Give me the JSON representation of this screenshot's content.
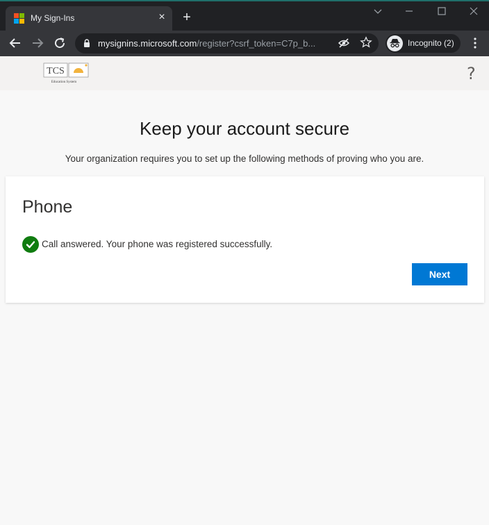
{
  "browser": {
    "tab_title": "My Sign-Ins",
    "new_tab": "+",
    "close_tab": "×",
    "url_host": "mysignins.microsoft.com",
    "url_path": "/register?csrf_token=C7p_b...",
    "incognito_label": "Incognito (2)"
  },
  "header": {
    "logo_text": "TCS",
    "logo_subtext": "Education System",
    "help_label": "?"
  },
  "main": {
    "heading": "Keep your account secure",
    "subheading": "Your organization requires you to set up the following methods of proving who you are.",
    "card": {
      "title": "Phone",
      "status_message": "Call answered. Your phone was registered successfully.",
      "next_label": "Next"
    }
  },
  "colors": {
    "accent": "#0078d4",
    "success": "#107c10",
    "chrome_dark": "#202124",
    "chrome_toolbar": "#35363a"
  }
}
